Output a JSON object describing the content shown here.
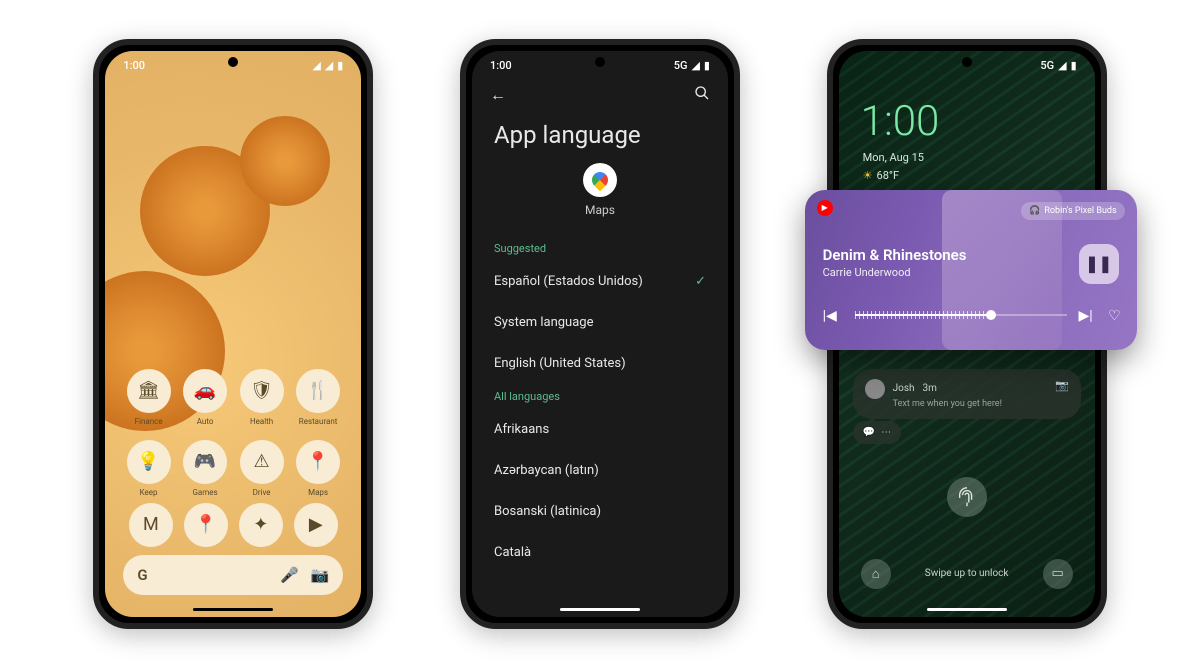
{
  "phone1": {
    "time": "1:00",
    "status_icons": [
      "signal",
      "wifi",
      "battery"
    ],
    "apps_row1": [
      {
        "icon": "🏛",
        "label": "Finance"
      },
      {
        "icon": "🚗",
        "label": "Auto"
      },
      {
        "icon": "🛡",
        "label": "Health"
      },
      {
        "icon": "🍴",
        "label": "Restaurant"
      }
    ],
    "apps_row2": [
      {
        "icon": "💡",
        "label": "Keep"
      },
      {
        "icon": "🎮",
        "label": "Games"
      },
      {
        "icon": "⚠",
        "label": "Drive"
      },
      {
        "icon": "📍",
        "label": "Maps"
      }
    ],
    "dock": [
      {
        "icon": "M",
        "name": "gmail-icon"
      },
      {
        "icon": "📍",
        "name": "maps-icon"
      },
      {
        "icon": "✦",
        "name": "photos-icon"
      },
      {
        "icon": "▶",
        "name": "youtube-icon"
      }
    ],
    "search": {
      "logo": "G",
      "mic": "🎤",
      "cam": "📷"
    }
  },
  "phone2": {
    "time": "1:00",
    "network": "5G",
    "title": "App language",
    "app_name": "Maps",
    "suggested_label": "Suggested",
    "suggested": [
      {
        "name": "Español (Estados Unidos)",
        "selected": true
      },
      {
        "name": "System language",
        "selected": false
      },
      {
        "name": "English (United States)",
        "selected": false
      }
    ],
    "all_label": "All languages",
    "all": [
      "Afrikaans",
      "Azərbaycan (latın)",
      "Bosanski (latinica)",
      "Català"
    ]
  },
  "phone3": {
    "network": "5G",
    "time": "1:00",
    "date": "Mon, Aug 15",
    "temp": "68°F",
    "media": {
      "device": "Robin's Pixel Buds",
      "title": "Denim & Rhinestones",
      "artist": "Carrie Underwood"
    },
    "notif": {
      "name": "Josh",
      "time": "3m",
      "msg": "Text me when you get here!"
    },
    "unlock_hint": "Swipe up to unlock"
  }
}
